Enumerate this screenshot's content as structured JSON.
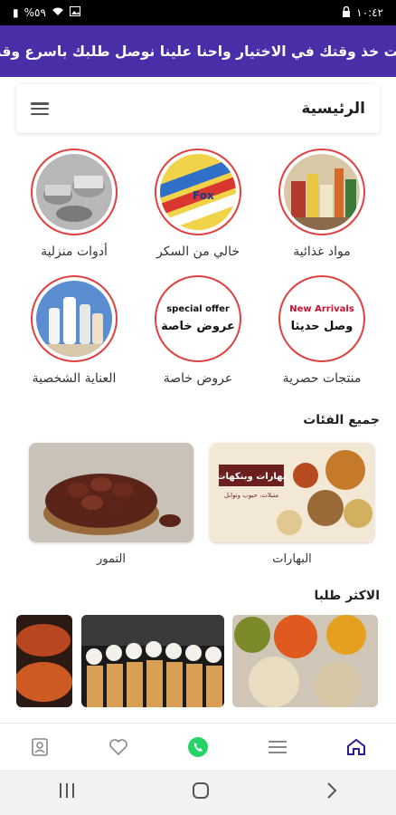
{
  "status_bar": {
    "battery": "%٥٩",
    "time": "١٠:٤٢"
  },
  "banner": {
    "text": "انت خذ وقتك في الاختيار واحنا علينا نوصل طلبك باسرع وقت"
  },
  "header": {
    "title": "الرئيسية"
  },
  "categories": [
    {
      "label": "مواد غذائية"
    },
    {
      "label": "خالي من السكر"
    },
    {
      "label": "أدوات منزلية"
    },
    {
      "label": "منتجات حصرية"
    },
    {
      "label": "عروض خاصة"
    },
    {
      "label": "العناية الشخصية"
    }
  ],
  "category_image_text": {
    "sugar_free": "Fox",
    "special_offer_en": "special offer",
    "special_offer_ar": "عروض خاصة",
    "exclusive_en": "New Arrivals",
    "exclusive_ar": "وصل حديثا"
  },
  "all_categories": {
    "title": "جميع الفئات",
    "items": [
      {
        "label": "البهارات",
        "image_text_1": "بهارات وبنكهات",
        "image_text_2": "متبلات، حبوب وتوابل"
      },
      {
        "label": "التمور"
      }
    ]
  },
  "most_ordered": {
    "title": "الاكثر طلبا"
  },
  "bottom_nav": [
    "home-icon",
    "list-icon",
    "whatsapp-icon",
    "heart-icon",
    "profile-icon"
  ],
  "colors": {
    "banner": "#4a2ea8",
    "accent": "#2a1e8f",
    "ring": "#e04040",
    "whatsapp": "#25d366"
  }
}
